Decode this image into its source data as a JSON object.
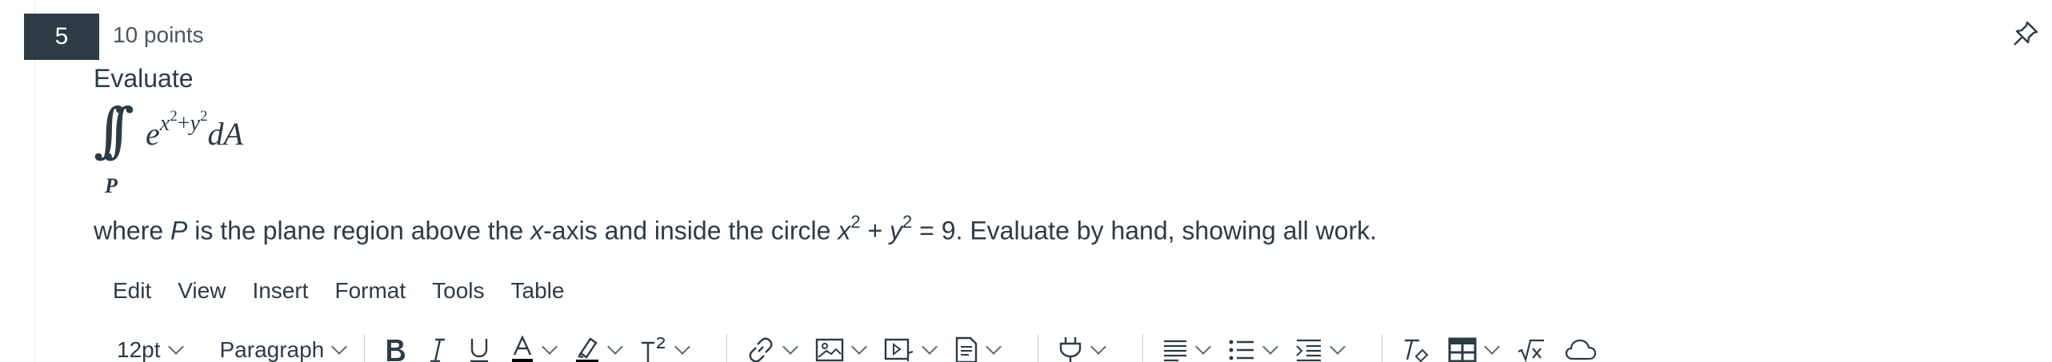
{
  "question": {
    "number": "5",
    "points": "10 points",
    "prompt_label": "Evaluate",
    "formula": {
      "region": "P",
      "base": "e",
      "exponent_x": "x",
      "exponent_two_a": "2",
      "exponent_plus": "+",
      "exponent_y": "y",
      "exponent_two_b": "2",
      "differential": "dA"
    },
    "description": {
      "part1": "where ",
      "P": "P",
      "part2": " is the plane region above the ",
      "x": "x",
      "part3": "-axis and inside the circle ",
      "x2": "x",
      "sup2a": "2",
      "plus": " + ",
      "y2": "y",
      "sup2b": "2",
      "part4": " = 9. Evaluate by hand, showing all work."
    }
  },
  "editor": {
    "menu": [
      "Edit",
      "View",
      "Insert",
      "Format",
      "Tools",
      "Table"
    ],
    "font_size": "12pt",
    "block_format": "Paragraph",
    "toolbar_icons": [
      "bold-icon",
      "italic-icon",
      "underline-icon",
      "text-color-icon",
      "highlight-icon",
      "superscript-icon",
      "link-icon",
      "image-icon",
      "media-icon",
      "document-icon",
      "plugin-icon",
      "align-icon",
      "bullet-list-icon",
      "indent-icon",
      "clear-format-icon",
      "table-icon",
      "math-icon",
      "cloud-icon"
    ]
  },
  "colors": {
    "badge_bg": "#2d3b45",
    "text": "#2d3b45",
    "muted": "#4b565e"
  }
}
